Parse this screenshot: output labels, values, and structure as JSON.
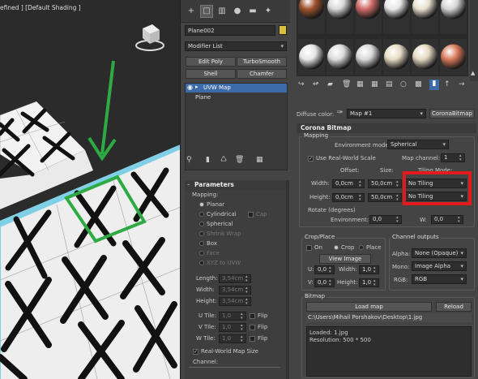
{
  "viewport": {
    "label": "efined ] [Default Shading ]"
  },
  "command_panel": {
    "object_name": "Plane002",
    "object_color": "#d9c23a",
    "modifier_list": "Modifier List",
    "buttons": [
      "Edit Poly",
      "TurboSmooth",
      "Shell",
      "Chamfer"
    ],
    "stack": [
      {
        "label": "UVW Map",
        "selected": true
      },
      {
        "label": "Plane",
        "selected": false
      }
    ],
    "parameters": {
      "title": "Parameters",
      "mapping_label": "Mapping:",
      "mapping_options": [
        {
          "label": "Planar",
          "on": true,
          "enabled": true
        },
        {
          "label": "Cylindrical",
          "on": false,
          "enabled": true,
          "extra": "Cap"
        },
        {
          "label": "Spherical",
          "on": false,
          "enabled": true
        },
        {
          "label": "Shrink Wrap",
          "on": false,
          "enabled": false
        },
        {
          "label": "Box",
          "on": false,
          "enabled": true
        },
        {
          "label": "Face",
          "on": false,
          "enabled": false
        },
        {
          "label": "XYZ to UVW",
          "on": false,
          "enabled": false
        }
      ],
      "dims": [
        {
          "label": "Length:",
          "value": "3,54cm"
        },
        {
          "label": "Width:",
          "value": "3,54cm"
        },
        {
          "label": "Height:",
          "value": "3,54cm"
        }
      ],
      "tiles": [
        {
          "label": "U Tile:",
          "value": "1,0",
          "flip": "Flip"
        },
        {
          "label": "V Tile:",
          "value": "1,0",
          "flip": "Flip"
        },
        {
          "label": "W Tile:",
          "value": "1,0",
          "flip": "Flip"
        }
      ],
      "real_world": "Real-World Map Size",
      "channel_label": "Channel:"
    }
  },
  "material": {
    "spheres": [
      [
        "#a0522d",
        "#d8d8d8",
        "#d06a6a",
        "#e8e8e8",
        "#e9e2d0",
        "#d5d5d5"
      ],
      [
        "#e6e6e6",
        "#dcdcdc",
        "#d9d9d9",
        "#e7dcc4",
        "#e5d8c1",
        "#d97a5a"
      ]
    ],
    "diffuse_label": "Diffuse color:",
    "map_name": "Map #1",
    "map_type": "CoronaBitmap",
    "rollout_title": "Corona Bitmap",
    "mapping": {
      "title": "Mapping",
      "env_label": "Environment mode:",
      "env_value": "Spherical",
      "real_world": "Use Real-World Scale",
      "channel_label": "Map channel:",
      "channel_value": "1",
      "offset_label": "Offset:",
      "size_label": "Size:",
      "tiling_label": "Tiling Mode:",
      "width_label": "Width:",
      "height_label": "Height:",
      "width_offset": "0,0cm",
      "width_size": "50,0cm",
      "height_offset": "0,0cm",
      "height_size": "50,0cm",
      "width_tiling": "No Tiling",
      "height_tiling": "No Tiling",
      "rotate_title": "Rotate (degrees)",
      "env_rot_label": "Environment:",
      "env_rot_value": "0,0",
      "w_label": "W:",
      "w_value": "0,0"
    },
    "crop": {
      "title": "Crop/Place",
      "on": "On",
      "crop": "Crop",
      "place": "Place",
      "view_image": "View Image",
      "u_label": "U:",
      "u": "0,0",
      "width_label": "Width:",
      "width": "1,0",
      "v_label": "V:",
      "v": "0,0",
      "height_label": "Height:",
      "height": "1,0"
    },
    "outputs": {
      "title": "Channel outputs",
      "alpha_label": "Alpha:",
      "alpha": "None (Opaque)",
      "mono_label": "Mono:",
      "mono": "Image Alpha",
      "rgb_label": "RGB:",
      "rgb": "RGB"
    },
    "bitmap": {
      "title": "Bitmap",
      "load": "Load map",
      "reload": "Reload",
      "path": "C:\\Users\\Mihail Porshakov\\Desktop\\1.jpg",
      "info1": "Loaded: 1.jpg",
      "info2": "Resolution: 500 * 500"
    }
  }
}
